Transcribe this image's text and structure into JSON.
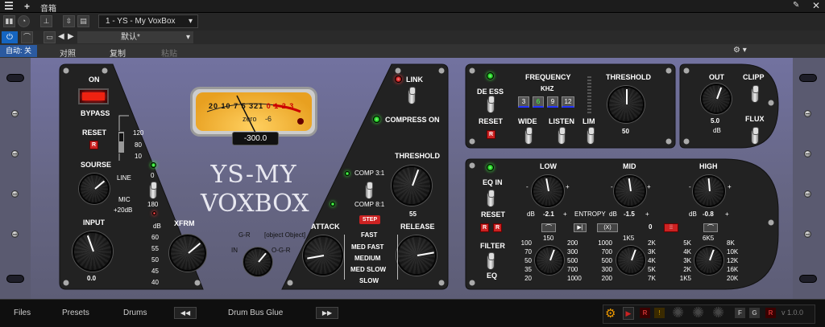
{
  "window": {
    "title": "音箱",
    "pin_icon": "pin-icon",
    "close_icon": "close-icon"
  },
  "toolbar": {
    "track": "1 - YS - My VoxBox",
    "preset": "默认*",
    "auto_label": "自动: 关",
    "compare": "对照",
    "copy": "复制",
    "paste": "粘贴"
  },
  "plugin": {
    "logo_line1": "YS-MY",
    "logo_line2": "VOXBOX",
    "on": "ON",
    "bypass": "BYPASS",
    "reset": "RESET",
    "r": "R",
    "freq120": "120",
    "freq80": "80",
    "freq10": "10",
    "sourse": "SOURSE",
    "line": "LINE",
    "mic": "MIC",
    "mic20": "+20dB",
    "phase0": "0",
    "phase180": "180",
    "input": "INPUT",
    "input_val": "0.0",
    "xfrm": "XFRM",
    "xfrm_db": "dB",
    "xfrm_scale": [
      "60",
      "55",
      "50",
      "45",
      "40"
    ],
    "meter_scale": [
      "20",
      "10",
      "7",
      "5",
      "3",
      "2",
      "1",
      "0",
      "1",
      "2",
      "3"
    ],
    "meter_zero": "zero",
    "meter_neg6": "-6",
    "meter_readout": "-300.0",
    "gr": "G-R",
    "out": {
      "out": "OUT",
      "out_val": "5.0",
      "db": "dB",
      "clipp": "CLIPP",
      "flux": "FLUX"
    },
    "in": "IN",
    "ogr": "O-G-R",
    "link": "LINK",
    "compress_on": "COMPRESS ON",
    "threshold": "THRESHOLD",
    "threshold_val": "55",
    "comp31": "COMP 3:1",
    "comp81": "COMP 8:1",
    "step": "STEP",
    "attack": "ATTACK",
    "release": "RELEASE",
    "speeds": [
      "FAST",
      "MED FAST",
      "MEDIUM",
      "MED SLOW",
      "SLOW"
    ],
    "deess": {
      "label": "DE ESS",
      "reset": "RESET",
      "frequency": "FREQUENCY",
      "khz": "KHZ",
      "bands": [
        "3",
        "6",
        "9",
        "12"
      ],
      "wide": "WIDE",
      "listen": "LISTEN",
      "lim": "LIM",
      "threshold": "THRESHOLD",
      "threshold_val": "50"
    },
    "eq": {
      "eqin": "EQ IN",
      "reset": "RESET",
      "filter": "FILTER",
      "eq": "EQ",
      "low": "LOW",
      "mid": "MID",
      "high": "HIGH",
      "entropy": "ENTROPY",
      "low_val": "-2.1",
      "mid_val": "-1.5",
      "high_val": "-0.8",
      "db": "dB",
      "minus": "-",
      "plus": "+",
      "zero": "0",
      "x": "(X)",
      "low_freq_title": "150",
      "low_left": [
        "100",
        "70",
        "50",
        "35",
        "20"
      ],
      "low_right": [
        "200",
        "300",
        "500",
        "700",
        "1000"
      ],
      "mid_freq_title": "1K5",
      "mid_left": [
        "1000",
        "700",
        "500",
        "300",
        "200"
      ],
      "mid_right": [
        "2K",
        "3K",
        "4K",
        "5K",
        "7K"
      ],
      "high_freq_title": "6K5",
      "high_left": [
        "5K",
        "4K",
        "3K",
        "2K",
        "1K5"
      ],
      "high_right": [
        "8K",
        "10K",
        "12K",
        "16K",
        "20K"
      ]
    }
  },
  "bottombar": {
    "files": "Files",
    "presets": "Presets",
    "drums": "Drums",
    "preset_name": "Drum Bus Glue",
    "prev": "◀◀",
    "next": "▶▶",
    "version": "v 1.0.0",
    "f": "F",
    "g": "G",
    "r": "R"
  }
}
